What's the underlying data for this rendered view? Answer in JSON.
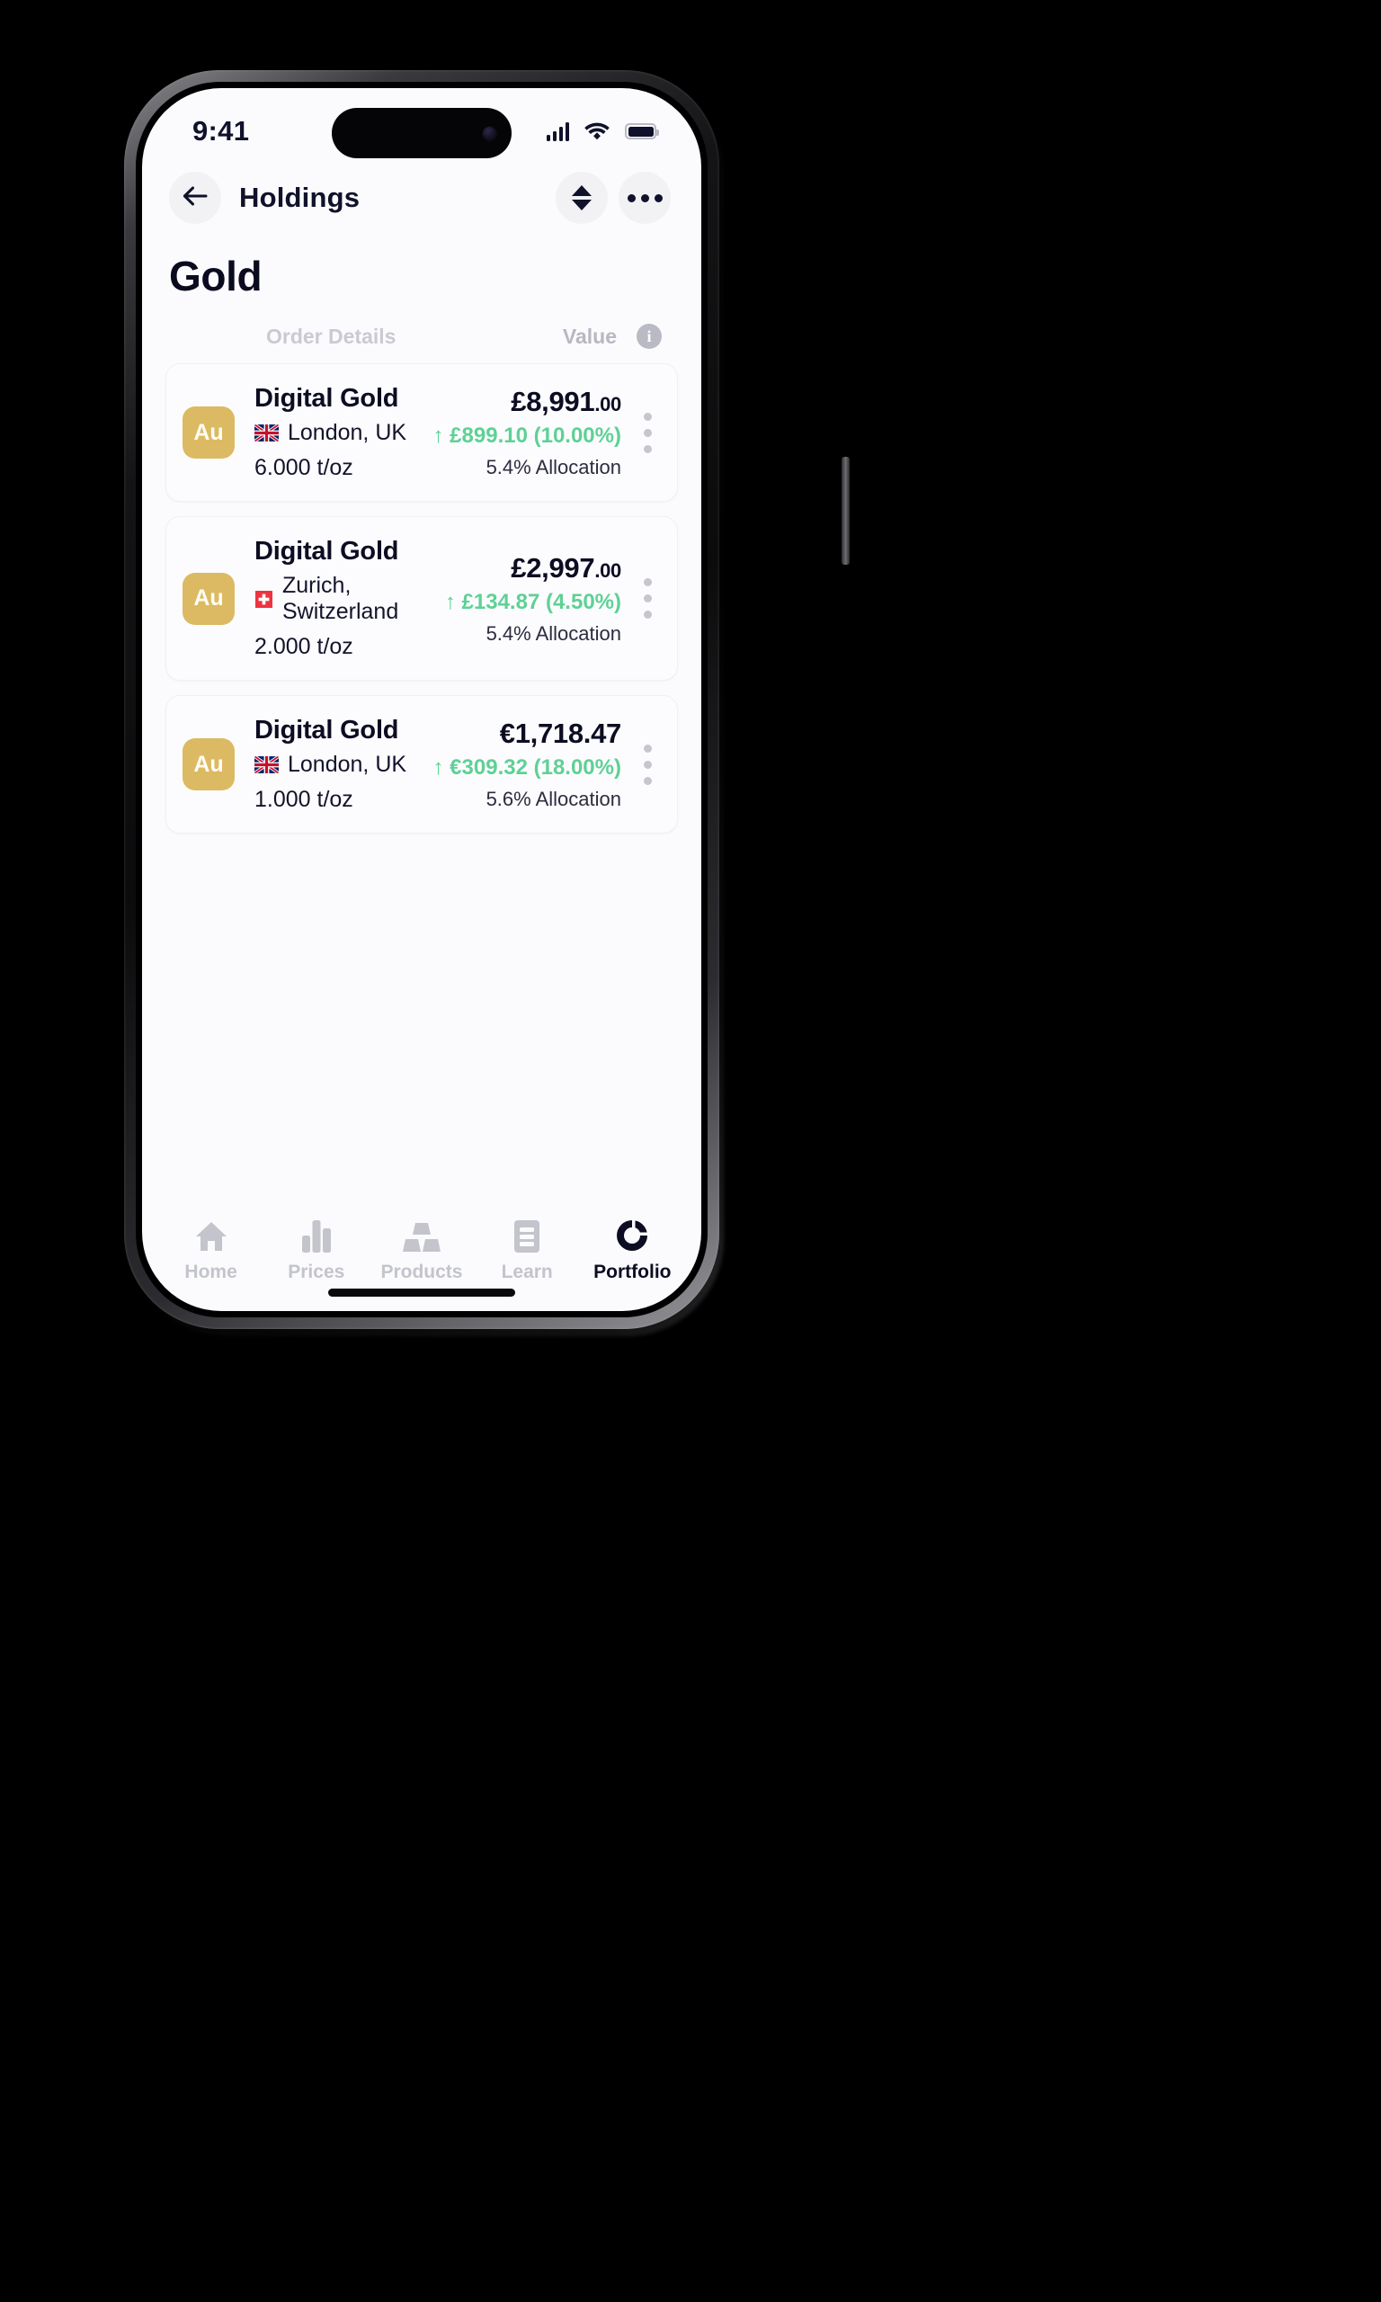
{
  "status_bar": {
    "time": "9:41",
    "cellular_icon": "cellular-bars-icon",
    "wifi_icon": "wifi-icon",
    "battery_icon": "battery-full-icon"
  },
  "nav": {
    "back_icon": "arrow-left-icon",
    "title": "Holdings",
    "sort_icon": "sort-up-down-icon",
    "more_icon": "more-horizontal-icon"
  },
  "page": {
    "title": "Gold"
  },
  "columns": {
    "order_details": "Order Details",
    "value": "Value",
    "info_icon": "info-icon",
    "info_glyph": "i"
  },
  "holdings": [
    {
      "symbol": "Au",
      "name": "Digital Gold",
      "flag": "uk-flag",
      "location": "London, UK",
      "quantity": "6.000 t/oz",
      "value_main": "£8,991",
      "value_decimals": ".00",
      "gain": "↑ £899.10 (10.00%)",
      "allocation": "5.4% Allocation",
      "menu_icon": "more-vertical-icon"
    },
    {
      "symbol": "Au",
      "name": "Digital Gold",
      "flag": "swiss-flag",
      "location": "Zurich, Switzerland",
      "quantity": "2.000 t/oz",
      "value_main": "£2,997",
      "value_decimals": ".00",
      "gain": "↑ £134.87 (4.50%)",
      "allocation": "5.4% Allocation",
      "menu_icon": "more-vertical-icon"
    },
    {
      "symbol": "Au",
      "name": "Digital Gold",
      "flag": "uk-flag",
      "location": "London, UK",
      "quantity": "1.000 t/oz",
      "value_main": "€1,718.47",
      "value_decimals": "",
      "gain": "↑ €309.32 (18.00%)",
      "allocation": "5.6% Allocation",
      "menu_icon": "more-vertical-icon"
    }
  ],
  "tabs": [
    {
      "label": "Home",
      "icon": "home-icon",
      "active": false
    },
    {
      "label": "Prices",
      "icon": "bar-chart-icon",
      "active": false
    },
    {
      "label": "Products",
      "icon": "gold-bars-icon",
      "active": false
    },
    {
      "label": "Learn",
      "icon": "document-icon",
      "active": false
    },
    {
      "label": "Portfolio",
      "icon": "donut-chart-icon",
      "active": true
    }
  ],
  "colors": {
    "accent_gold": "#dcba63",
    "gain_green": "#5ed195",
    "text_dark": "#0c0d22",
    "muted": "#c3c4cc"
  }
}
